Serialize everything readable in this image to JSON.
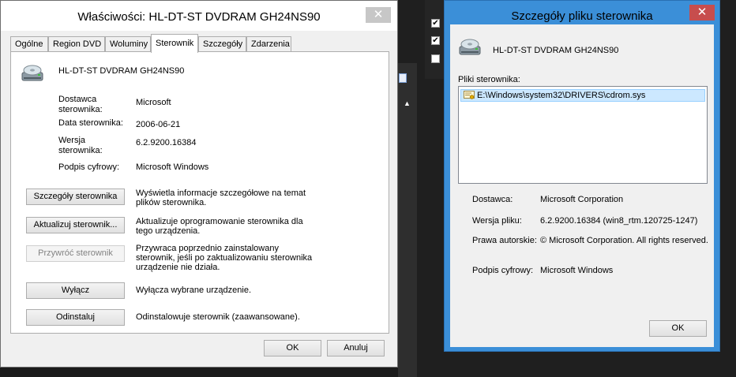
{
  "properties_window": {
    "title": "Właściwości: HL-DT-ST DVDRAM GH24NS90",
    "close_glyph": "✕",
    "tabs": [
      "Ogólne",
      "Region DVD",
      "Woluminy",
      "Sterownik",
      "Szczegóły",
      "Zdarzenia"
    ],
    "active_tab": "Sterownik",
    "device_name": "HL-DT-ST DVDRAM GH24NS90",
    "props": {
      "provider_label": "Dostawca sterownika:",
      "provider_value": "Microsoft",
      "date_label": "Data sterownika:",
      "date_value": "2006-06-21",
      "version_label": "Wersja sterownika:",
      "version_value": "6.2.9200.16384",
      "signer_label": "Podpis cyfrowy:",
      "signer_value": "Microsoft Windows"
    },
    "actions": [
      {
        "label": "Szczegóły sterownika",
        "desc": "Wyświetla informacje szczegółowe na temat plików sterownika."
      },
      {
        "label": "Aktualizuj sterownik...",
        "desc": "Aktualizuje oprogramowanie sterownika dla tego urządzenia."
      },
      {
        "label": "Przywróć sterownik",
        "desc": "Przywraca poprzednio zainstalowany sterownik, jeśli po zaktualizowaniu sterownika urządzenie nie działa."
      },
      {
        "label": "Wyłącz",
        "desc": "Wyłącza wybrane urządzenie."
      },
      {
        "label": "Odinstaluj",
        "desc": "Odinstalowuje sterownik (zaawansowane)."
      }
    ],
    "ok_label": "OK",
    "cancel_label": "Anuluj"
  },
  "details_window": {
    "title": "Szczegóły pliku sterownika",
    "close_glyph": "✕",
    "device_name": "HL-DT-ST DVDRAM GH24NS90",
    "files_label": "Pliki sterownika:",
    "files": [
      "E:\\Windows\\system32\\DRIVERS\\cdrom.sys"
    ],
    "provider_label": "Dostawca:",
    "provider_value": "Microsoft Corporation",
    "version_label": "Wersja pliku:",
    "version_value": "6.2.9200.16384 (win8_rtm.120725-1247)",
    "copyright_label": "Prawa autorskie:",
    "copyright_value": "© Microsoft Corporation. All rights reserved.",
    "signer_label": "Podpis cyfrowy:",
    "signer_value": "Microsoft Windows",
    "ok_label": "OK"
  },
  "background": {
    "checkmark": "✔",
    "arrow": "▲"
  },
  "colors": {
    "details_titlebar": "#3b8fd8",
    "close_active": "#c74d4d",
    "selection": "#cce8ff"
  }
}
